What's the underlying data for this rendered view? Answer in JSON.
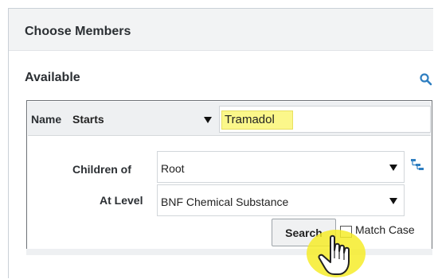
{
  "dialog": {
    "title": "Choose Members",
    "section_title": "Available"
  },
  "filter": {
    "name_label": "Name",
    "operator_value": "Starts",
    "search_term": "Tramadol",
    "children_label": "Children of",
    "children_value": "Root",
    "level_label": "At Level",
    "level_value": "BNF Chemical Substance",
    "search_button": "Search",
    "match_case_label": "Match Case",
    "match_case_checked": false
  },
  "icons": {
    "search": "search-icon",
    "hierarchy": "hierarchy-icon",
    "cursor": "hand-pointer-icon"
  },
  "colors": {
    "accent_blue": "#2f7fc1",
    "highlight_yellow": "#fbf78a",
    "cursor_halo": "#f6ec2a"
  }
}
